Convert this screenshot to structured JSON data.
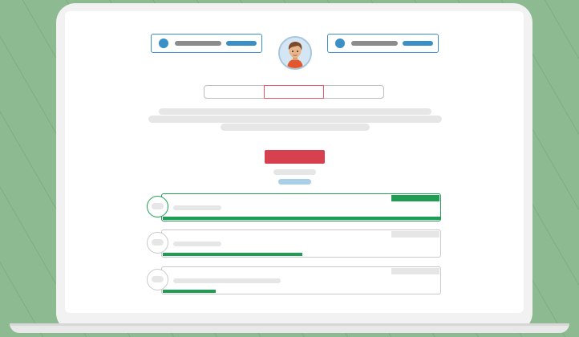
{
  "colors": {
    "background": "#8dba90",
    "accent_blue": "#3a8fc6",
    "accent_red": "#d7414f",
    "accent_green": "#1e9e52",
    "skeleton": "#e6e6e6"
  },
  "header": {
    "left_participant": {
      "icon": "dot-icon"
    },
    "avatar": {
      "icon": "person-avatar-icon"
    },
    "right_participant": {
      "icon": "dot-icon"
    }
  },
  "tabs": [
    {
      "active": false
    },
    {
      "active": true
    },
    {
      "active": false
    }
  ],
  "options": [
    {
      "selected": true,
      "progress": 1.0
    },
    {
      "selected": false,
      "progress": 0.5
    },
    {
      "selected": false,
      "progress": 0.19
    }
  ]
}
